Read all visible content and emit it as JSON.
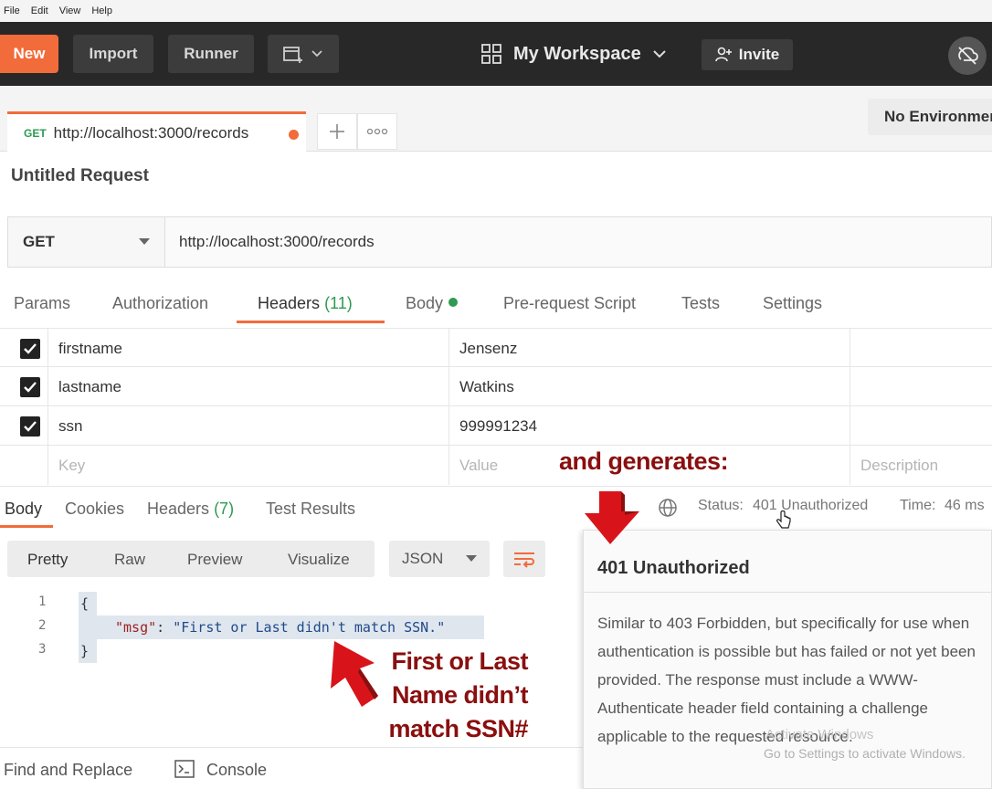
{
  "menu": [
    "File",
    "Edit",
    "View",
    "Help"
  ],
  "topbar": {
    "new_label": "New",
    "import_label": "Import",
    "runner_label": "Runner",
    "workspace_label": "My Workspace",
    "invite_label": "Invite"
  },
  "tab": {
    "method": "GET",
    "url": "http://localhost:3000/records",
    "add_icon": "plus-icon",
    "more_icon": "more-icon"
  },
  "environment": {
    "label": "No Environment"
  },
  "request": {
    "title": "Untitled Request",
    "method": "GET",
    "url": "http://localhost:3000/records"
  },
  "request_tabs": {
    "params": "Params",
    "authorization": "Authorization",
    "headers": "Headers",
    "headers_count": "(11)",
    "body": "Body",
    "prerequest": "Pre-request Script",
    "tests": "Tests",
    "settings": "Settings"
  },
  "headers_table": {
    "rows": [
      {
        "key": "firstname",
        "value": "Jensenz",
        "checked": true
      },
      {
        "key": "lastname",
        "value": "Watkins",
        "checked": true
      },
      {
        "key": "ssn",
        "value": "999991234",
        "checked": true
      }
    ],
    "key_placeholder": "Key",
    "value_placeholder": "Value",
    "description_placeholder": "Description"
  },
  "response_tabs": {
    "body": "Body",
    "cookies": "Cookies",
    "headers": "Headers",
    "headers_count": "(7)",
    "test_results": "Test Results"
  },
  "status": {
    "label": "Status:",
    "value": "401 Unauthorized",
    "time_label": "Time:",
    "time_value": "46 ms"
  },
  "response_view": {
    "pretty": "Pretty",
    "raw": "Raw",
    "preview": "Preview",
    "visualize": "Visualize",
    "format": "JSON"
  },
  "code": {
    "lines": [
      "{",
      "\"msg\": \"First or Last didn't match SSN.\"",
      "}"
    ],
    "key": "\"msg\"",
    "colon": ": ",
    "value": "\"First or Last didn't match SSN.\""
  },
  "bottom": {
    "find_replace": "Find and Replace",
    "console": "Console"
  },
  "tooltip": {
    "title": "401 Unauthorized",
    "body": "Similar to 403 Forbidden, but specifically for use when authentication is possible but has failed or not yet been provided. The response must include a WWW-Authenticate header field containing a challenge applicable to the requested resource."
  },
  "watermark": {
    "line1": "Activate Windows",
    "line2": "Go to Settings to activate Windows."
  },
  "annotations": {
    "top": "and generates:",
    "left_line1": "First or Last",
    "left_line2": "Name didn’t",
    "left_line3": "match SSN#"
  },
  "colors": {
    "accent": "#f26b3a",
    "status_green": "#2e9a52",
    "annotation": "#8a0f0f"
  }
}
